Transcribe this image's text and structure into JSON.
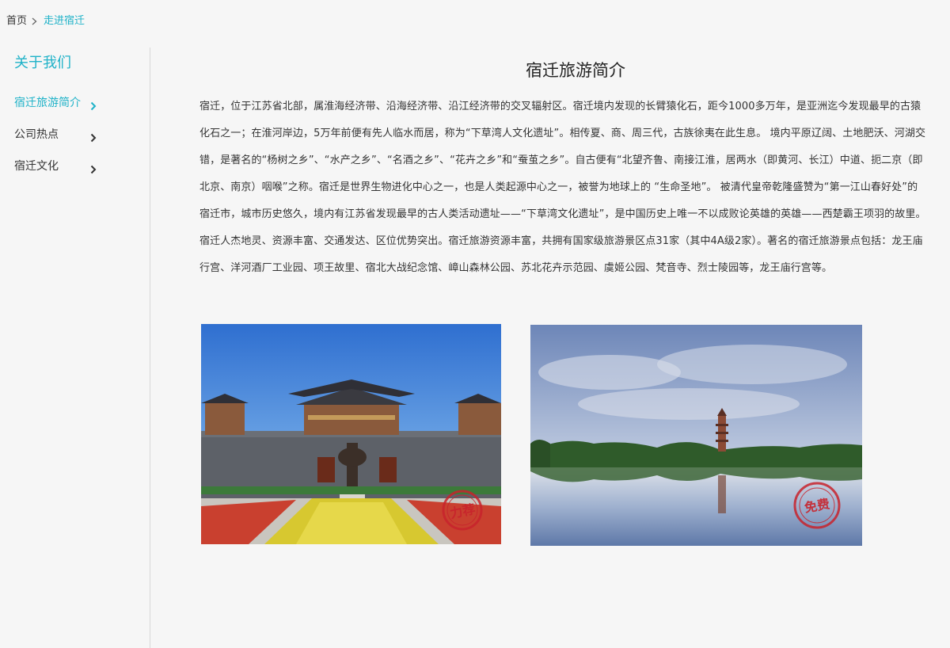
{
  "breadcrumb": {
    "home": "首页",
    "current": "走进宿迁"
  },
  "sidebar": {
    "title": "关于我们",
    "items": [
      {
        "label": "宿迁旅游简介",
        "active": true
      },
      {
        "label": "公司热点",
        "active": false
      },
      {
        "label": "宿迁文化",
        "active": false
      }
    ]
  },
  "main": {
    "title": "宿迁旅游简介",
    "body": "宿迁，位于江苏省北部，属淮海经济带、沿海经济带、沿江经济带的交叉辐射区。宿迁境内发现的长臂猿化石，距今1000多万年，是亚洲迄今发现最早的古猿化石之一；在淮河岸边，5万年前便有先人临水而居，称为“下草湾人文化遗址”。相传夏、商、周三代，古族徐夷在此生息。 境内平原辽阔、土地肥沃、河湖交错，是著名的“杨树之乡”、“水产之乡”、“名酒之乡”、“花卉之乡”和“蚕茧之乡”。自古便有“北望齐鲁、南接江淮，居两水（即黄河、长江）中道、扼二京（即北京、南京）咽喉”之称。宿迁是世界生物进化中心之一，也是人类起源中心之一，被誉为地球上的 “生命圣地”。 被清代皇帝乾隆盛赞为“第一江山春好处”的宿迁市，城市历史悠久，境内有江苏省发现最早的古人类活动遗址——“下草湾文化遗址”，是中国历史上唯一不以成败论英雄的英雄——西楚霸王项羽的故里。宿迁人杰地灵、资源丰富、交通发达、区位优势突出。宿迁旅游资源丰富，共拥有国家级旅游景区点31家（其中4A级2家）。著名的宿迁旅游景点包括：龙王庙行宫、洋河酒厂工业园、项王故里、宿北大战纪念馆、嶂山森林公园、苏北花卉示范园、虞姬公园、梵音寺、烈士陵园等，龙王庙行宫等。",
    "photos": [
      {
        "stamp": "力荐"
      },
      {
        "stamp": "免费"
      }
    ]
  },
  "colors": {
    "accent": "#1fb2c8",
    "background": "#f6f6f6",
    "text": "#333333",
    "stamp": "#c8232c"
  },
  "icons": {
    "breadcrumb_separator": "chevron-right-icon",
    "sidebar_item": "chevron-right-icon"
  }
}
